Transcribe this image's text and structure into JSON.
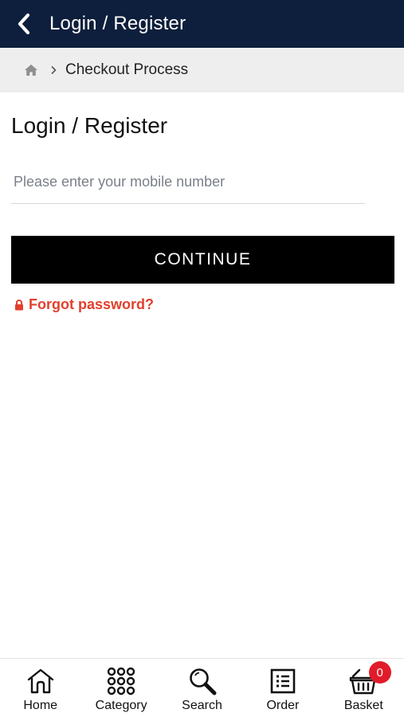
{
  "header": {
    "title": "Login / Register",
    "back_icon": "chevron-left-icon"
  },
  "breadcrumb": {
    "home_icon": "home-icon",
    "separator_icon": "chevron-right-icon",
    "current": "Checkout Process"
  },
  "login": {
    "heading": "Login / Register",
    "mobile_placeholder": "Please enter your mobile number",
    "mobile_value": "",
    "continue_label": "CONTINUE",
    "forgot_label": "Forgot password?",
    "forgot_icon": "lock-icon"
  },
  "bottom_nav": {
    "items": [
      {
        "label": "Home",
        "icon": "home-outline-icon"
      },
      {
        "label": "Category",
        "icon": "grid-dots-icon"
      },
      {
        "label": "Search",
        "icon": "search-icon"
      },
      {
        "label": "Order",
        "icon": "list-icon"
      },
      {
        "label": "Basket",
        "icon": "basket-icon",
        "badge": "0"
      }
    ]
  },
  "colors": {
    "header_bg": "#0d1f3c",
    "breadcrumb_bg": "#eeeeee",
    "button_bg": "#000000",
    "link_red": "#e2402e",
    "badge_red": "#e21b2a"
  }
}
